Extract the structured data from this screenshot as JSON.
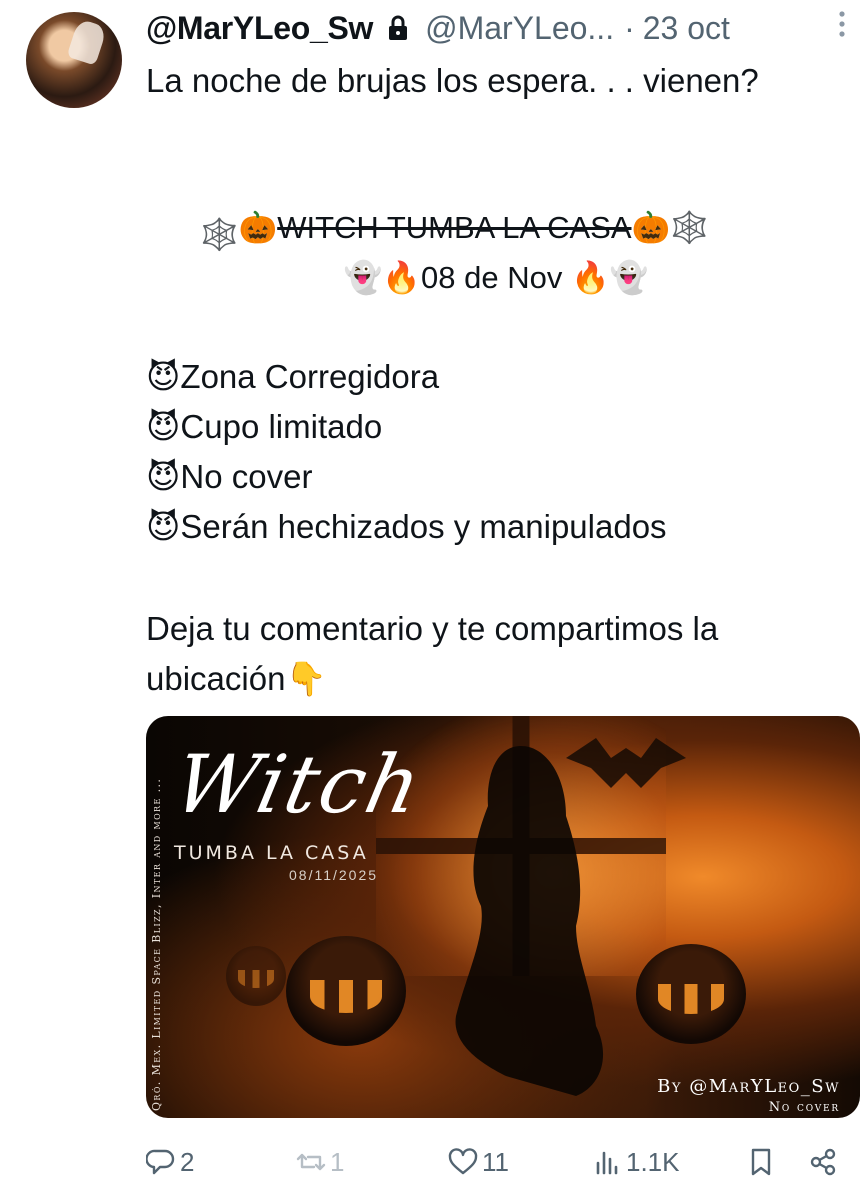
{
  "tweet": {
    "display_name": "@MarYLeo_Sw",
    "handle": "@MarYLeo...",
    "separator": "·",
    "date": "23 oct",
    "text_intro": "La noche de brujas los espera. . . vienen?",
    "title_line": "WITCH TUMBA LA CASA",
    "date_line": "08 de Nov",
    "bullets": [
      "Zona Corregidora",
      "Cupo limitado",
      "No cover",
      "Serán hechizados y manipulados"
    ],
    "closing": "Deja tu comentario y te compartimos la",
    "closing2": "ubicación"
  },
  "image": {
    "side_text": "Qró. Mex. Limited Space Blizz, Inter and more ...",
    "title": "Witch",
    "subtitle": "TUMBA LA CASA",
    "event_date": "08/11/2025",
    "by": "By @MarYLeo_Sw",
    "cover": "No cover"
  },
  "actions": {
    "reply_count": "2",
    "retweet_count": "1",
    "like_count": "11",
    "views_count": "1.1K"
  },
  "icons": [
    "lock-icon",
    "more-icon",
    "reply-icon",
    "retweet-icon",
    "like-icon",
    "views-icon",
    "bookmark-icon",
    "share-icon"
  ],
  "colors": {
    "text": "#0f1419",
    "muted": "#536471"
  }
}
